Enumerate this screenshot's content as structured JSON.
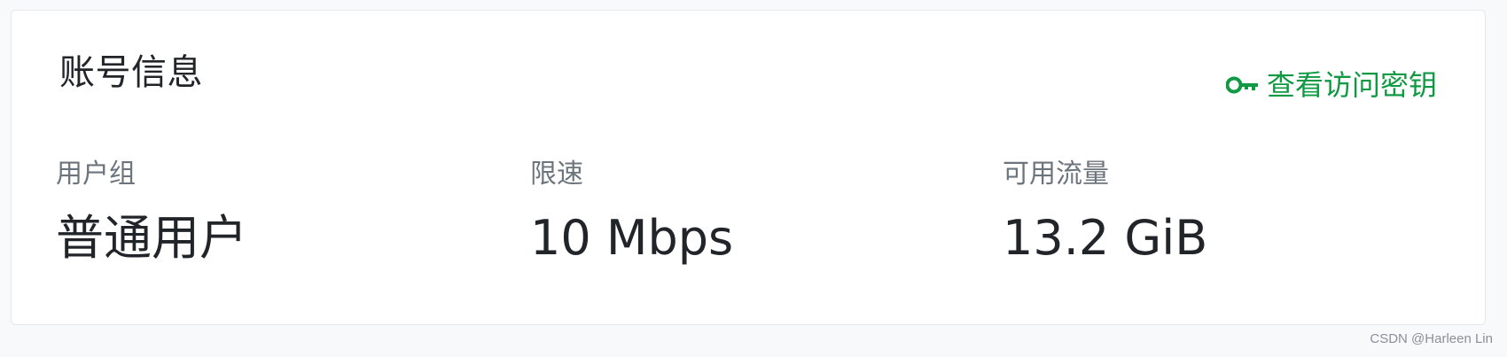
{
  "card": {
    "title": "账号信息",
    "action": {
      "icon": "key-icon",
      "label": "查看访问密钥",
      "color": "#109943"
    },
    "stats": [
      {
        "label": "用户组",
        "value": "普通用户"
      },
      {
        "label": "限速",
        "value": "10 Mbps"
      },
      {
        "label": "可用流量",
        "value": "13.2 GiB"
      }
    ]
  },
  "watermark": "CSDN @Harleen Lin"
}
